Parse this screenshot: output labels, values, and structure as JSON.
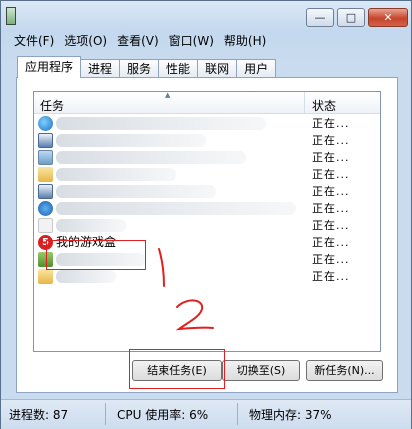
{
  "window": {
    "title_buttons": {
      "minimize": "—",
      "maximize": "□",
      "close": "✕"
    }
  },
  "menubar": {
    "items": [
      "文件(F)",
      "选项(O)",
      "查看(V)",
      "窗口(W)",
      "帮助(H)"
    ]
  },
  "tabs": [
    "应用程序",
    "进程",
    "服务",
    "性能",
    "联网",
    "用户"
  ],
  "active_tab": "应用程序",
  "task_list": {
    "columns": {
      "task": "任务",
      "status": "状态"
    },
    "rows": [
      {
        "icon": "ie-icon",
        "name": "",
        "status": "正在..."
      },
      {
        "icon": "window-icon",
        "name": "",
        "status": "正在..."
      },
      {
        "icon": "picture-icon",
        "name": "",
        "status": "正在..."
      },
      {
        "icon": "folder-icon",
        "name": "",
        "status": "正在..."
      },
      {
        "icon": "window-icon",
        "name": "",
        "status": "正在..."
      },
      {
        "icon": "ie-icon",
        "name": "",
        "status": "正在..."
      },
      {
        "icon": "blank-icon",
        "name": "",
        "status": "正在..."
      },
      {
        "icon": "game-icon",
        "name": "我的游戏盒",
        "status": "正在..."
      },
      {
        "icon": "app-icon",
        "name": "",
        "status": "正在..."
      },
      {
        "icon": "folder-icon",
        "name": "",
        "status": "正在..."
      }
    ]
  },
  "annotations": {
    "mark_1": "1",
    "mark_2": "2"
  },
  "buttons": {
    "end_task": "结束任务(E)",
    "switch_to": "切换至(S)",
    "new_task": "新任务(N)..."
  },
  "statusbar": {
    "processes": "进程数: 87",
    "cpu": "CPU 使用率: 6%",
    "memory": "物理内存: 37%"
  },
  "colors": {
    "annotation_red": "#e02020",
    "window_frame": "#c3d8ee",
    "close_button": "#c6442a"
  }
}
